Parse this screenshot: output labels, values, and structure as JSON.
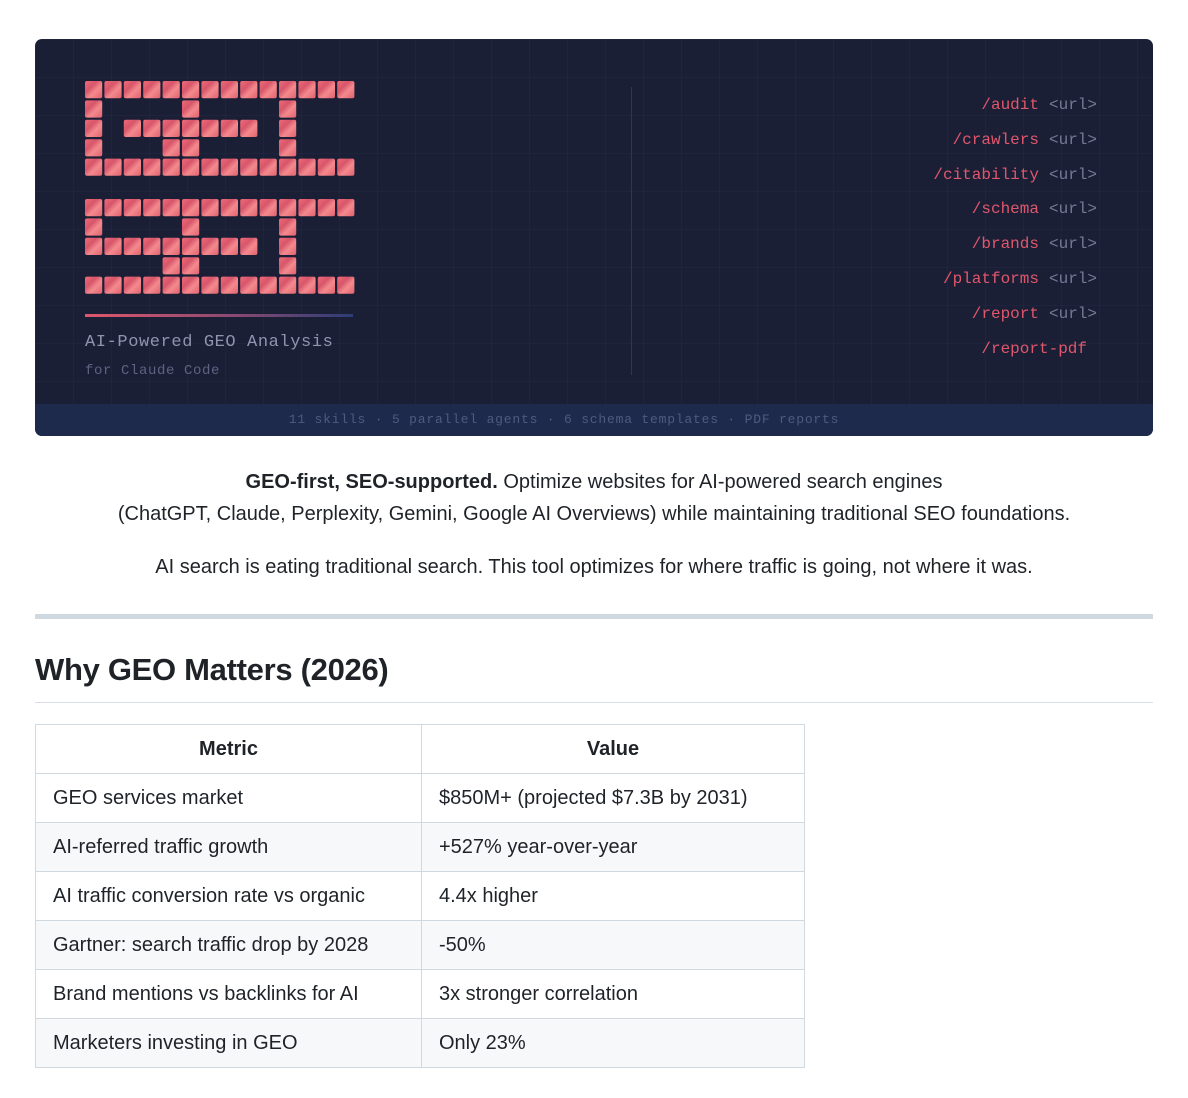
{
  "banner": {
    "logo_lines": [
      "GEO",
      "SEO"
    ],
    "tagline": "AI-Powered GEO Analysis",
    "subtagline": "for Claude Code",
    "commands": [
      {
        "name": "/audit",
        "arg": "<url>"
      },
      {
        "name": "/crawlers",
        "arg": "<url>"
      },
      {
        "name": "/citability",
        "arg": "<url>"
      },
      {
        "name": "/schema",
        "arg": "<url>"
      },
      {
        "name": "/brands",
        "arg": "<url>"
      },
      {
        "name": "/platforms",
        "arg": "<url>"
      },
      {
        "name": "/report",
        "arg": "<url>"
      },
      {
        "name": "/report-pdf",
        "arg": ""
      }
    ],
    "footer": "11 skills · 5 parallel agents · 6 schema templates · PDF reports",
    "colors": {
      "background": "#1b1f36",
      "accent": "#e0576c",
      "footer_bg": "#1d2a4c"
    }
  },
  "intro": {
    "lead_bold": "GEO-first, SEO-supported.",
    "lead_rest": " Optimize websites for AI-powered search engines",
    "lead_line2": "(ChatGPT, Claude, Perplexity, Gemini, Google AI Overviews) while maintaining traditional SEO foundations.",
    "second": "AI search is eating traditional search. This tool optimizes for where traffic is going, not where it was."
  },
  "section": {
    "title": "Why GEO Matters (2026)"
  },
  "table": {
    "headers": [
      "Metric",
      "Value"
    ],
    "rows": [
      [
        "GEO services market",
        "$850M+ (projected $7.3B by 2031)"
      ],
      [
        "AI-referred traffic growth",
        "+527% year-over-year"
      ],
      [
        "AI traffic conversion rate vs organic",
        "4.4x higher"
      ],
      [
        "Gartner: search traffic drop by 2028",
        "-50%"
      ],
      [
        "Brand mentions vs backlinks for AI",
        "3x stronger correlation"
      ],
      [
        "Marketers investing in GEO",
        "Only 23%"
      ]
    ]
  }
}
